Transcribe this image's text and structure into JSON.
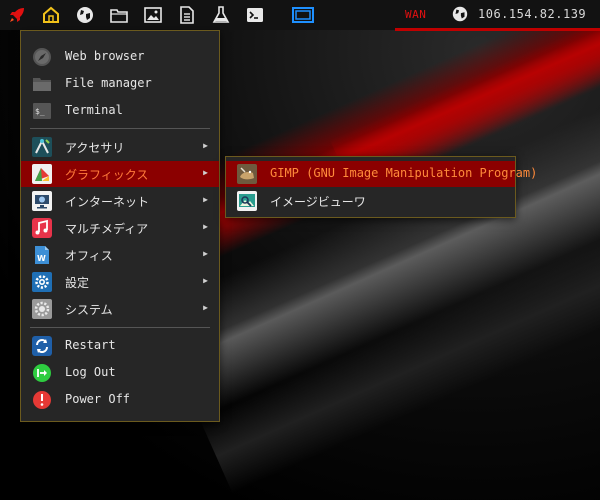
{
  "panel": {
    "icons": [
      "rocket-icon",
      "home-icon",
      "globe-icon",
      "folder-icon",
      "image-icon",
      "document-icon",
      "flask-icon",
      "terminal-icon",
      "window-switch-icon"
    ],
    "network_label": "WAN",
    "ip_address": "106.154.82.139",
    "accent_color": "#c00000"
  },
  "main_menu": {
    "top_items": [
      {
        "label": "Web browser",
        "icon": "compass-icon"
      },
      {
        "label": "File manager",
        "icon": "folder-icon"
      },
      {
        "label": "Terminal",
        "icon": "terminal-icon"
      }
    ],
    "categories": [
      {
        "label": "アクセサリ",
        "icon": "accessories-icon",
        "arrow": "▶"
      },
      {
        "label": "グラフィックス",
        "icon": "graphics-icon",
        "arrow": "▶",
        "active": true
      },
      {
        "label": "インターネット",
        "icon": "network-icon",
        "arrow": "▶"
      },
      {
        "label": "マルチメディア",
        "icon": "music-icon",
        "arrow": "▶"
      },
      {
        "label": "オフィス",
        "icon": "office-icon",
        "arrow": "▶"
      },
      {
        "label": "設定",
        "icon": "settings-icon",
        "arrow": "▶"
      },
      {
        "label": "システム",
        "icon": "system-icon",
        "arrow": "▶"
      }
    ],
    "session_items": [
      {
        "label": "Restart",
        "icon": "restart-icon"
      },
      {
        "label": "Log Out",
        "icon": "logout-icon"
      },
      {
        "label": "Power Off",
        "icon": "power-icon"
      }
    ]
  },
  "graphics_submenu": {
    "items": [
      {
        "label": "GIMP (GNU Image Manipulation Program)",
        "icon": "gimp-icon",
        "active": true
      },
      {
        "label": "イメージビューワ",
        "icon": "image-viewer-icon"
      }
    ]
  }
}
